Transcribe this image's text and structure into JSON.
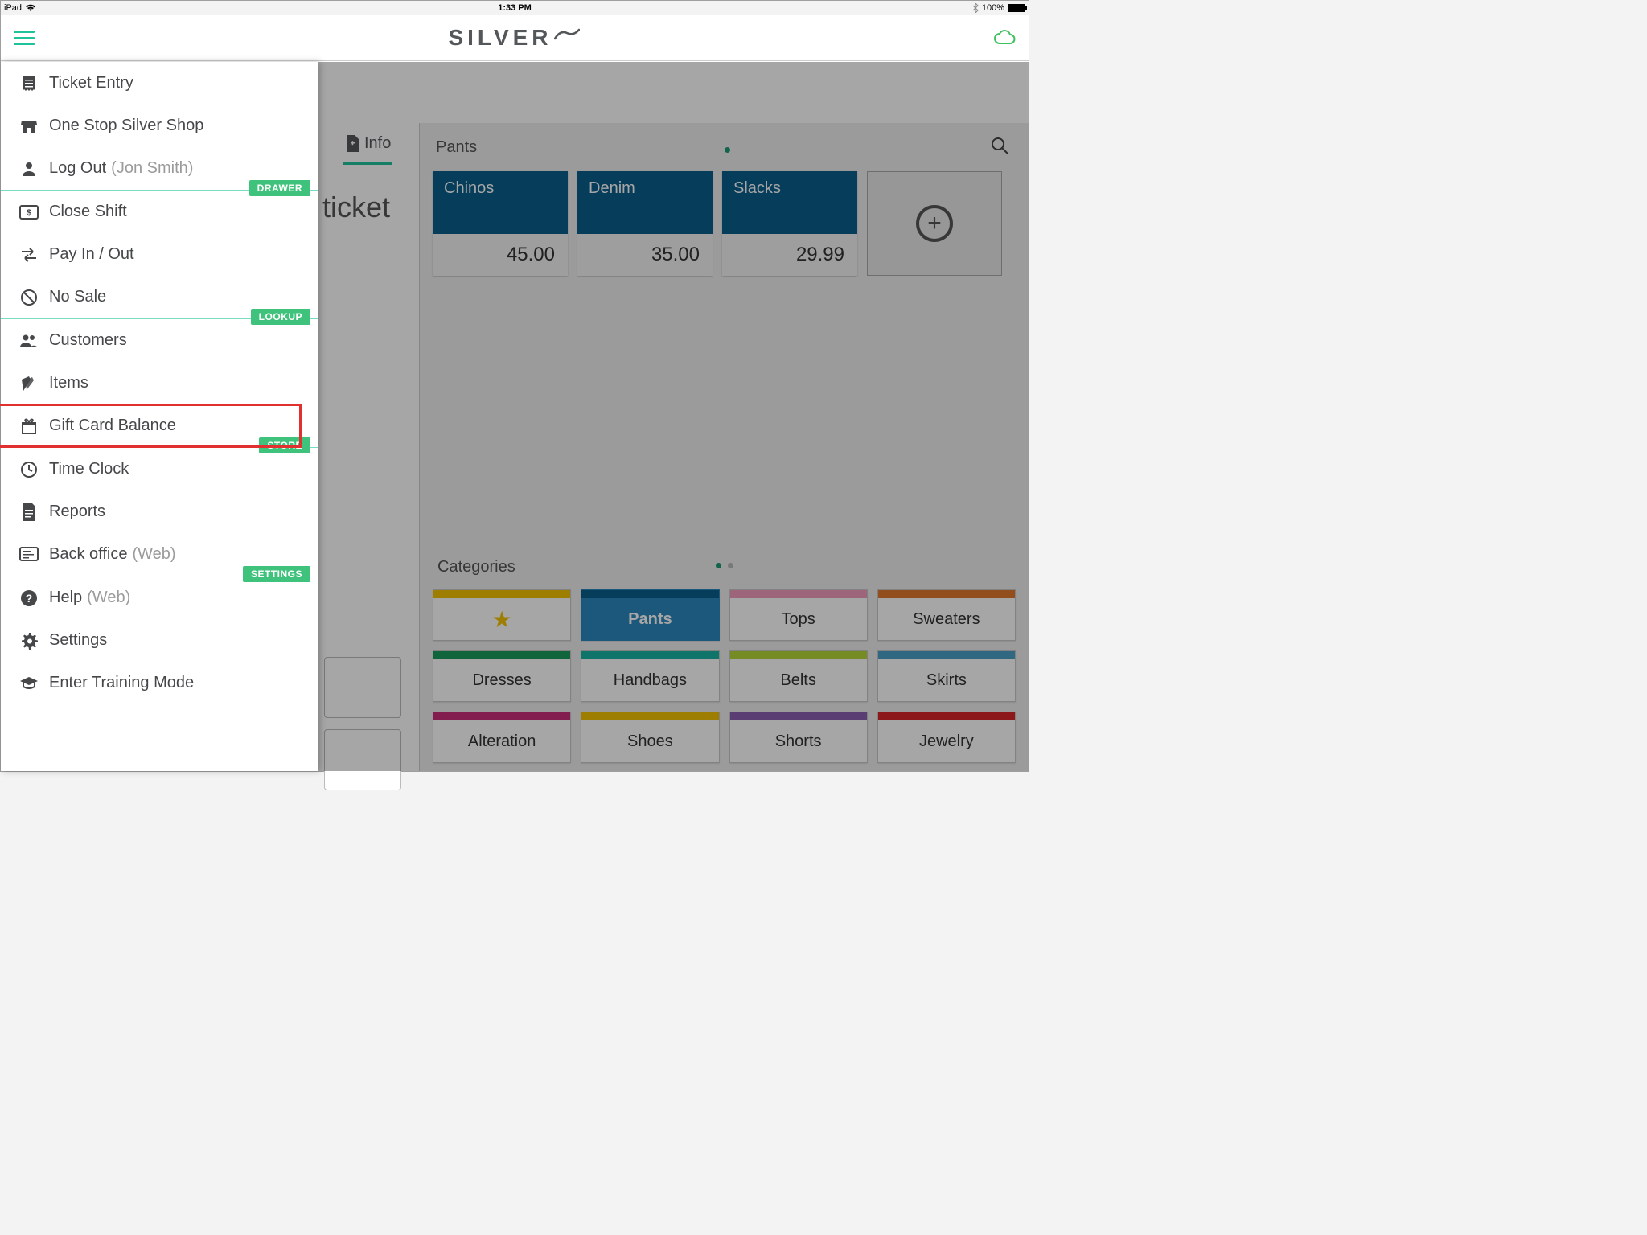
{
  "status": {
    "device": "iPad",
    "time": "1:33 PM",
    "battery": "100%"
  },
  "brand": "SILVER",
  "sidebar": {
    "items": [
      {
        "label": "Ticket Entry"
      },
      {
        "label": "One Stop Silver Shop"
      },
      {
        "label": "Log Out",
        "sub": "(Jon Smith)"
      }
    ],
    "drawer_tag": "DRAWER",
    "drawer": [
      {
        "label": "Close Shift"
      },
      {
        "label": "Pay In / Out"
      },
      {
        "label": "No Sale"
      }
    ],
    "lookup_tag": "LOOKUP",
    "lookup": [
      {
        "label": "Customers"
      },
      {
        "label": "Items"
      },
      {
        "label": "Gift Card Balance"
      }
    ],
    "store_tag": "STORE",
    "store": [
      {
        "label": "Time Clock"
      },
      {
        "label": "Reports"
      },
      {
        "label": "Back office",
        "sub": "(Web)"
      }
    ],
    "settings_tag": "SETTINGS",
    "settings": [
      {
        "label": "Help",
        "sub": "(Web)"
      },
      {
        "label": "Settings"
      },
      {
        "label": "Enter Training Mode"
      }
    ]
  },
  "peek": {
    "info": "Info",
    "ticket": "ticket"
  },
  "products": {
    "header": "Pants",
    "tiles": [
      {
        "name": "Chinos",
        "price": "45.00"
      },
      {
        "name": "Denim",
        "price": "35.00"
      },
      {
        "name": "Slacks",
        "price": "29.99"
      }
    ]
  },
  "categories": {
    "header": "Categories",
    "rows": [
      [
        {
          "label": "",
          "stripe": "#f2c200",
          "star": true
        },
        {
          "label": "Pants",
          "stripe": "#0a5e8c",
          "active": true
        },
        {
          "label": "Tops",
          "stripe": "#f29bbb"
        },
        {
          "label": "Sweaters",
          "stripe": "#e17a2d"
        }
      ],
      [
        {
          "label": "Dresses",
          "stripe": "#1a9b5e"
        },
        {
          "label": "Handbags",
          "stripe": "#17b3a2"
        },
        {
          "label": "Belts",
          "stripe": "#b7d63a"
        },
        {
          "label": "Skirts",
          "stripe": "#4aa0c6"
        }
      ],
      [
        {
          "label": "Alteration",
          "stripe": "#c92d7a"
        },
        {
          "label": "Shoes",
          "stripe": "#f2c200"
        },
        {
          "label": "Shorts",
          "stripe": "#8a5fb0"
        },
        {
          "label": "Jewelry",
          "stripe": "#d8262c"
        }
      ]
    ]
  }
}
